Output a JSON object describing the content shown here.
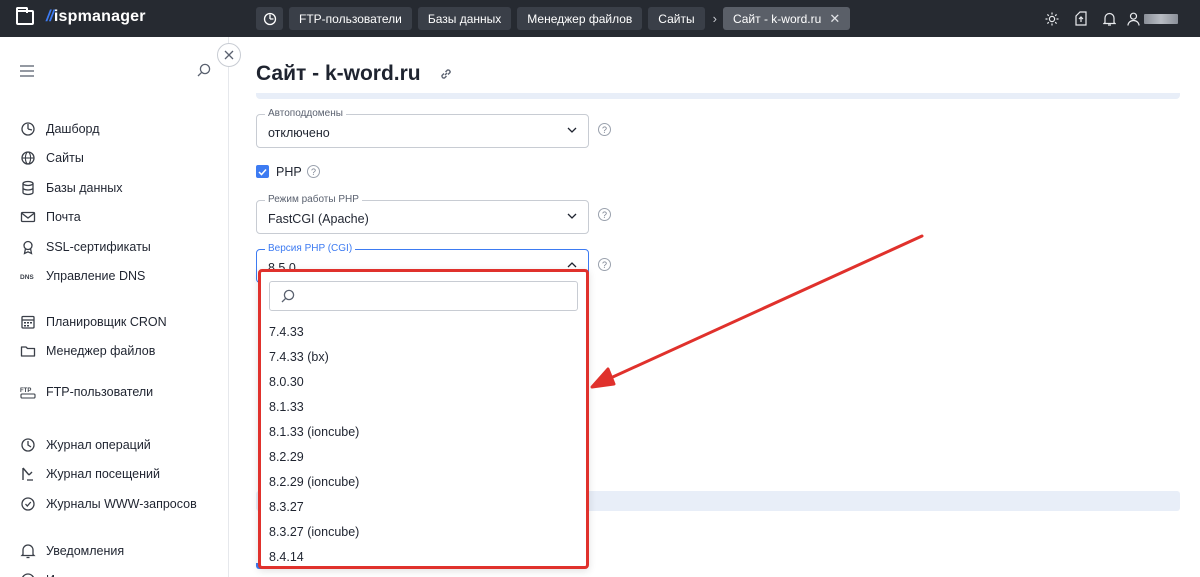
{
  "app": {
    "logo_text": "ispmanager",
    "logo_slash": "//"
  },
  "tabs": [
    {
      "label": "FTP-пользователи"
    },
    {
      "label": "Базы данных"
    },
    {
      "label": "Менеджер файлов"
    },
    {
      "label": "Сайты"
    }
  ],
  "active_tab": {
    "label": "Сайт - k-word.ru",
    "close": "✕"
  },
  "top_icons": [
    "sun-icon",
    "upload-icon",
    "bell-icon",
    "user-icon"
  ],
  "sidebar": {
    "groups": [
      [
        {
          "label": "Дашборд",
          "icon": "dashboard-icon"
        },
        {
          "label": "Сайты",
          "icon": "globe-icon"
        },
        {
          "label": "Базы данных",
          "icon": "database-icon"
        },
        {
          "label": "Почта",
          "icon": "mail-icon"
        },
        {
          "label": "SSL-сертификаты",
          "icon": "certificate-icon"
        },
        {
          "label": "Управление DNS",
          "icon": "dns-icon"
        }
      ],
      [
        {
          "label": "Планировщик CRON",
          "icon": "calendar-icon"
        },
        {
          "label": "Менеджер файлов",
          "icon": "folder-icon"
        }
      ],
      [
        {
          "label": "FTP-пользователи",
          "icon": "ftp-icon"
        }
      ],
      [
        {
          "label": "Журнал операций",
          "icon": "journal-icon"
        },
        {
          "label": "Журнал посещений",
          "icon": "visits-icon"
        },
        {
          "label": "Журналы WWW-запросов",
          "icon": "requests-icon"
        }
      ],
      [
        {
          "label": "Уведомления",
          "icon": "bell-icon"
        },
        {
          "label": "Использование диска",
          "icon": "disk-icon"
        }
      ]
    ]
  },
  "main": {
    "title": "Сайт - k-word.ru",
    "autosubdomains": {
      "label": "Автоподдомены",
      "value": "отключено"
    },
    "php": {
      "label": "PHP",
      "checked": true
    },
    "php_mode": {
      "label": "Режим работы PHP",
      "value": "FastCGI (Apache)"
    },
    "php_version": {
      "label": "Версия PHP (CGI)",
      "value": "8.5.0"
    },
    "help_glyph": "?"
  },
  "dropdown": {
    "search_placeholder": "",
    "options": [
      "7.4.33",
      "7.4.33 (bx)",
      "8.0.30",
      "8.1.33",
      "8.1.33 (ioncube)",
      "8.2.29",
      "8.2.29 (ioncube)",
      "8.3.27",
      "8.3.27 (ioncube)",
      "8.4.14"
    ]
  },
  "colors": {
    "accent": "#3d7bf2",
    "highlight": "#e0312c",
    "topbar": "#262a31"
  }
}
